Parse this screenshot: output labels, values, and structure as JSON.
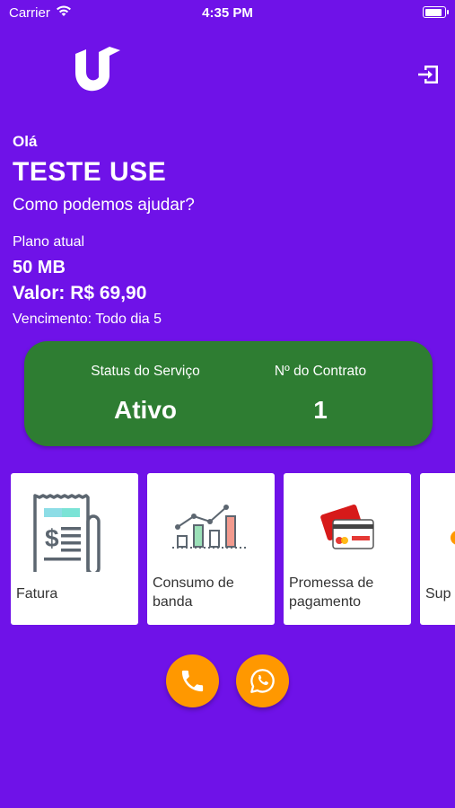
{
  "status_bar": {
    "carrier": "Carrier",
    "time": "4:35 PM",
    "battery_level": 0.9
  },
  "header": {
    "logo_icon": "u-logo-icon",
    "logout_icon": "logout-icon"
  },
  "greeting": {
    "hello": "Olá",
    "name": "TESTE USE",
    "prompt": "Como podemos ajudar?"
  },
  "plan": {
    "label": "Plano atual",
    "speed": "50 MB",
    "value": "Valor: R$ 69,90",
    "due": "Vencimento: Todo dia 5"
  },
  "service": {
    "status_label": "Status do Serviço",
    "status_value": "Ativo",
    "contract_label": "Nº do Contrato",
    "contract_value": "1",
    "card_color": "#2e7d32"
  },
  "cards": [
    {
      "label": "Fatura",
      "icon": "invoice-icon"
    },
    {
      "label": "Consumo de banda",
      "icon": "bandwidth-chart-icon"
    },
    {
      "label": "Promessa de pagamento",
      "icon": "credit-card-icon"
    },
    {
      "label": "Sup",
      "icon": "support-icon"
    }
  ],
  "actions": {
    "phone_icon": "phone-icon",
    "whatsapp_icon": "whatsapp-icon",
    "accent": "#ff9800"
  },
  "colors": {
    "background": "#6f12e8",
    "accent": "#ff9800",
    "status_green": "#2e7d32"
  }
}
